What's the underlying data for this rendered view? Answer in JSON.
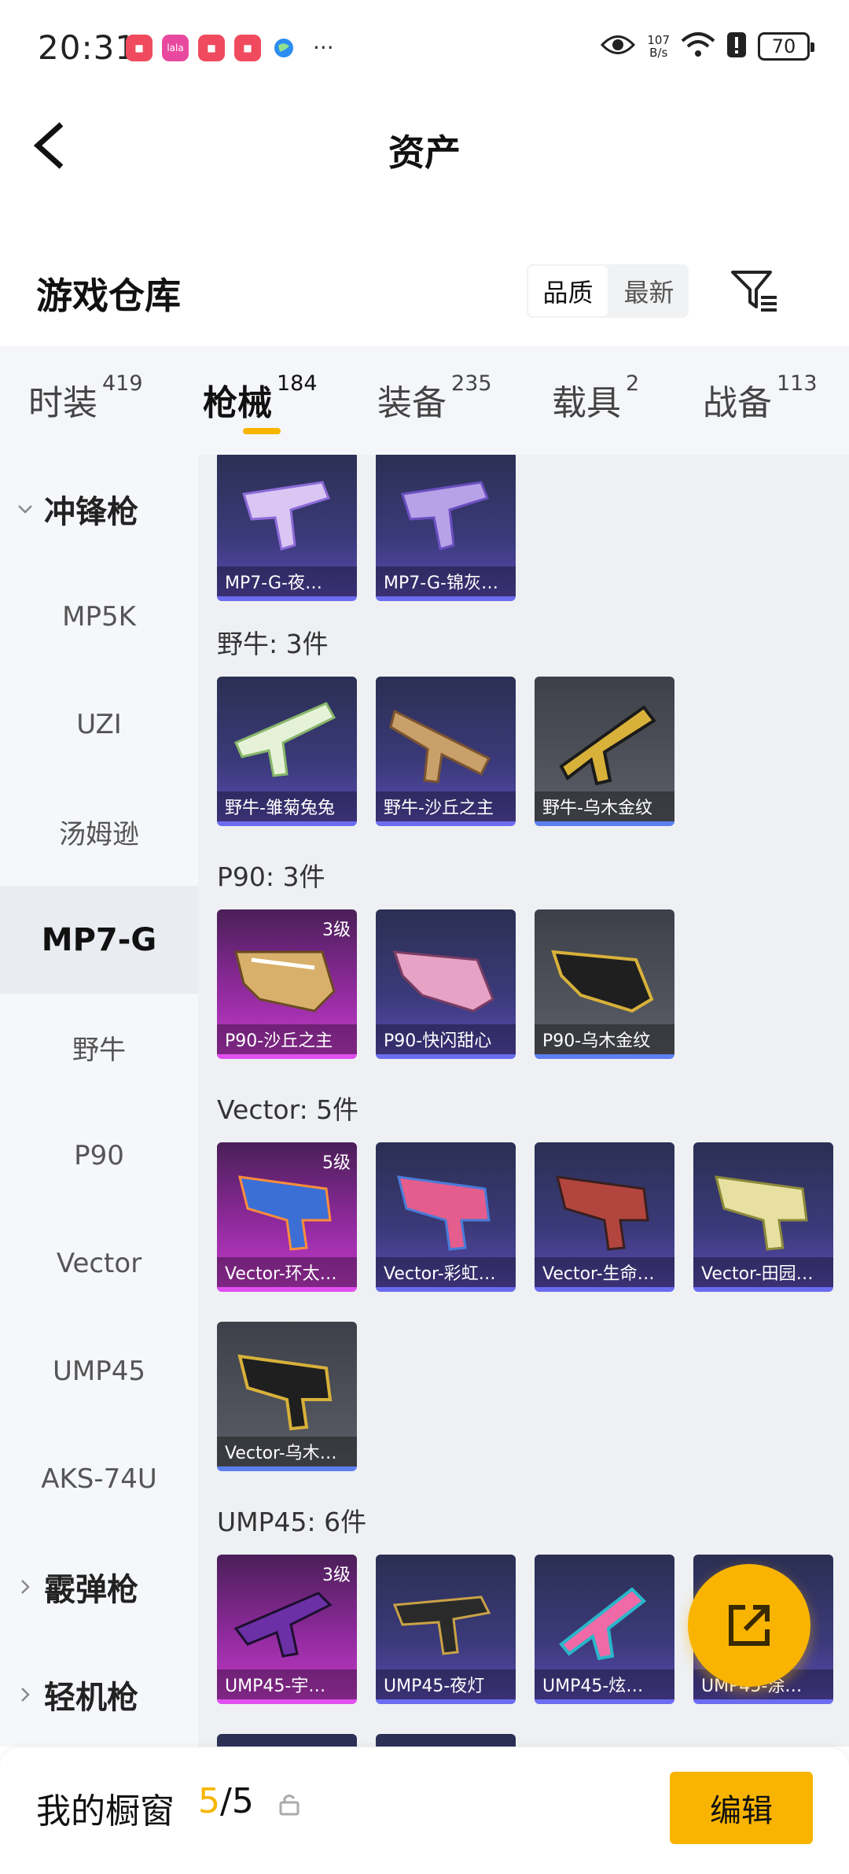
{
  "status_bar": {
    "time": "20:31",
    "net_speed_value": "107",
    "net_speed_unit": "B/s",
    "battery": "70",
    "more": "···",
    "app_badge_text": "lala"
  },
  "header": {
    "title": "资产"
  },
  "warehouse": {
    "title": "游戏仓库",
    "sort_options": [
      "品质",
      "最新"
    ],
    "active_sort": "品质"
  },
  "tabs": [
    {
      "label": "时装",
      "count": "419"
    },
    {
      "label": "枪械",
      "count": "184",
      "active": true
    },
    {
      "label": "装备",
      "count": "235"
    },
    {
      "label": "载具",
      "count": "2"
    },
    {
      "label": "战备",
      "count": "113"
    }
  ],
  "sidebar": {
    "items": [
      {
        "label": "冲锋枪",
        "group": true,
        "expanded": true
      },
      {
        "label": "MP5K"
      },
      {
        "label": "UZI"
      },
      {
        "label": "汤姆逊"
      },
      {
        "label": "MP7-G",
        "active": true
      },
      {
        "label": "野牛"
      },
      {
        "label": "P90"
      },
      {
        "label": "Vector"
      },
      {
        "label": "UMP45"
      },
      {
        "label": "AKS-74U"
      },
      {
        "label": "霰弹枪",
        "group": true
      },
      {
        "label": "轻机枪",
        "group": true
      }
    ]
  },
  "content": {
    "groups": [
      {
        "label": "",
        "items": [
          {
            "name": "MP7-G-夜…",
            "rarity": "blue"
          },
          {
            "name": "MP7-G-锦灰…",
            "rarity": "blue"
          }
        ]
      },
      {
        "label": "野牛: 3件",
        "items": [
          {
            "name": "野牛-雏菊兔兔",
            "rarity": "blue"
          },
          {
            "name": "野牛-沙丘之主",
            "rarity": "blue"
          },
          {
            "name": "野牛-乌木金纹",
            "rarity": "gray"
          }
        ]
      },
      {
        "label": "P90: 3件",
        "items": [
          {
            "name": "P90-沙丘之主",
            "rarity": "pink",
            "level": "3级"
          },
          {
            "name": "P90-快闪甜心",
            "rarity": "blue"
          },
          {
            "name": "P90-乌木金纹",
            "rarity": "gray"
          }
        ]
      },
      {
        "label": "Vector: 5件",
        "items": [
          {
            "name": "Vector-环太…",
            "rarity": "pink",
            "level": "5级"
          },
          {
            "name": "Vector-彩虹…",
            "rarity": "blue"
          },
          {
            "name": "Vector-生命…",
            "rarity": "blue"
          },
          {
            "name": "Vector-田园…",
            "rarity": "blue"
          },
          {
            "name": "Vector-乌木…",
            "rarity": "gray"
          }
        ]
      },
      {
        "label": "UMP45: 6件",
        "items": [
          {
            "name": "UMP45-宇…",
            "rarity": "pink",
            "level": "3级"
          },
          {
            "name": "UMP45-夜灯",
            "rarity": "blue"
          },
          {
            "name": "UMP45-炫…",
            "rarity": "blue"
          },
          {
            "name": "UMP45-涂…",
            "rarity": "blue"
          }
        ]
      }
    ]
  },
  "bottom_bar": {
    "title": "我的橱窗",
    "current": "5",
    "total": "/5",
    "edit_label": "编辑"
  },
  "colors": {
    "accent": "#f8b400",
    "rarity_pink": "#e14ff0",
    "rarity_blue": "#6b6cf0",
    "rarity_gray": "#5d7ff0"
  },
  "icons": {
    "back": "chevron-left-icon",
    "filter": "filter-icon",
    "share": "external-link-icon",
    "lock": "lock-icon",
    "eye": "eye-icon",
    "wifi": "wifi-icon"
  }
}
